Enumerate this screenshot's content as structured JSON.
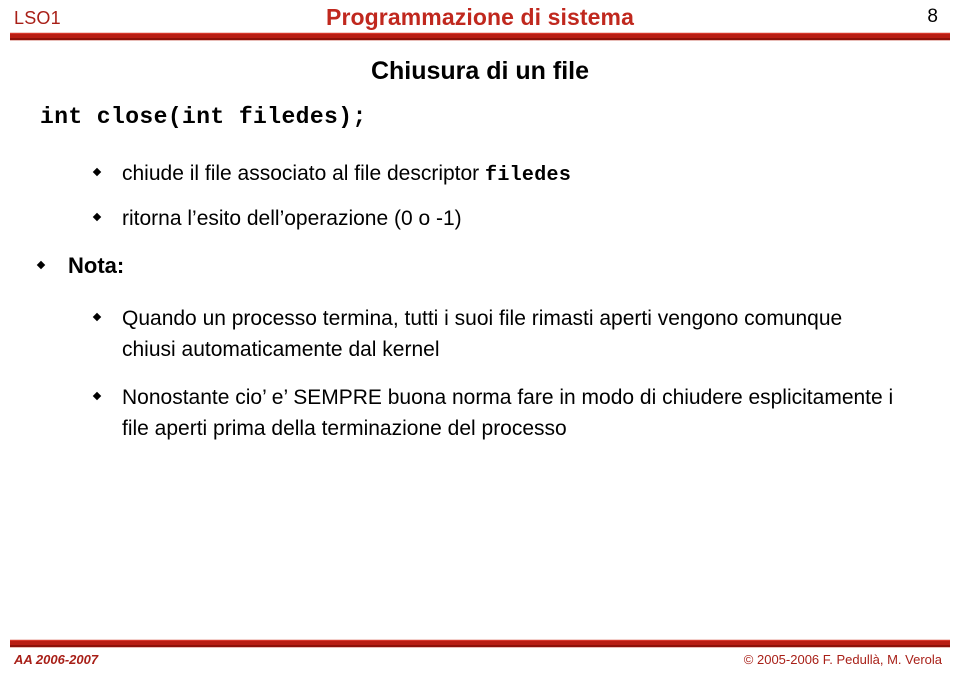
{
  "header": {
    "course_code": "LSO1",
    "title": "Programmazione di sistema",
    "page_number": "8"
  },
  "slide": {
    "title": "Chiusura di un file",
    "code_signature": "int close(int filedes);",
    "bullets": [
      {
        "level": 2,
        "text_before": "chiude il file associato al file descriptor ",
        "mono": "filedes",
        "text_after": ""
      },
      {
        "level": 2,
        "text_before": "ritorna l’esito dell’operazione (0 o -1)",
        "mono": "",
        "text_after": ""
      },
      {
        "level": 1,
        "text_before": "Nota:",
        "mono": "",
        "text_after": ""
      },
      {
        "level": 2,
        "text_before": "Quando un processo termina, tutti i suoi file rimasti aperti vengono comunque chiusi automaticamente dal kernel",
        "mono": "",
        "text_after": ""
      },
      {
        "level": 2,
        "text_before": "Nonostante cio’ e’ SEMPRE buona norma fare in modo di chiudere esplicitamente i file aperti prima della terminazione del processo",
        "mono": "",
        "text_after": ""
      }
    ],
    "bullet_glyph": "diamond-bullet-icon"
  },
  "footer": {
    "academic_year": "AA 2006-2007",
    "copyright": "© 2005-2006 F. Pedullà, M. Verola"
  },
  "colors": {
    "accent_red": "#c0281e",
    "dark_red": "#a81f17",
    "text_black": "#000000",
    "background": "#ffffff"
  }
}
